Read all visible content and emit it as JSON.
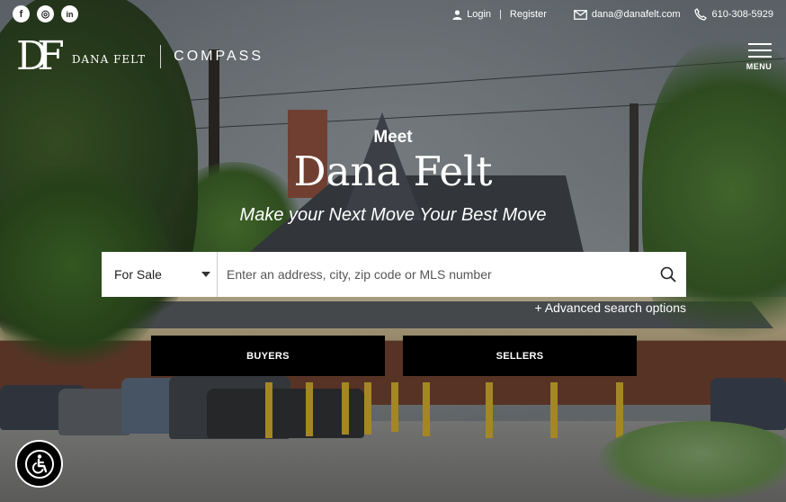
{
  "social": [
    {
      "name": "facebook-icon",
      "glyph": "f"
    },
    {
      "name": "instagram-icon",
      "glyph": "◎"
    },
    {
      "name": "linkedin-icon",
      "glyph": "in"
    }
  ],
  "topbar": {
    "login": "Login",
    "register": "Register",
    "separator": "|",
    "email": "dana@danafelt.com",
    "phone": "610-308-5929"
  },
  "logo": {
    "monogram": "DF",
    "name": "DANA FELT",
    "brokerage": "COMPASS"
  },
  "menu": {
    "label": "MENU"
  },
  "hero": {
    "meet": "Meet",
    "name": "Dana Felt",
    "tagline": "Make your Next Move Your Best Move"
  },
  "search": {
    "type_selected": "For Sale",
    "placeholder": "Enter an address, city, zip code or MLS number",
    "advanced": "+ Advanced search options"
  },
  "cta": {
    "buyers": "BUYERS",
    "sellers": "SELLERS"
  },
  "accessibility": {
    "icon": "accessibility-icon"
  }
}
